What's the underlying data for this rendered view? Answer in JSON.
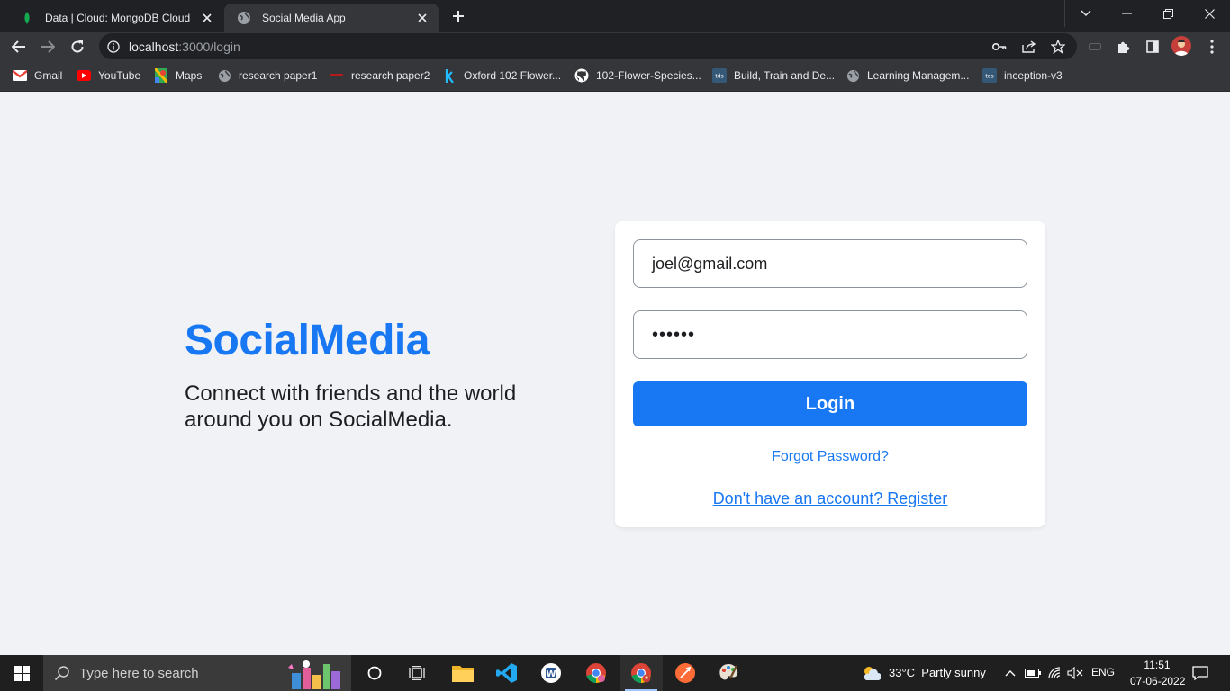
{
  "browser": {
    "tabs": [
      {
        "title": "Data | Cloud: MongoDB Cloud",
        "icon": "mongodb-leaf-icon",
        "active": false
      },
      {
        "title": "Social Media App",
        "icon": "globe-icon",
        "active": true
      }
    ],
    "address": {
      "host": "localhost",
      "path": ":3000/login"
    },
    "bookmarks": [
      {
        "label": "Gmail",
        "icon": "gmail-icon"
      },
      {
        "label": "YouTube",
        "icon": "youtube-icon"
      },
      {
        "label": "Maps",
        "icon": "maps-icon"
      },
      {
        "label": "research paper1",
        "icon": "globe-icon"
      },
      {
        "label": "research paper2",
        "icon": "red-dash-icon"
      },
      {
        "label": "Oxford 102 Flower...",
        "icon": "kaggle-icon"
      },
      {
        "label": "102-Flower-Species...",
        "icon": "github-icon"
      },
      {
        "label": "Build, Train and De...",
        "icon": "tds-icon"
      },
      {
        "label": "Learning Managem...",
        "icon": "globe-icon"
      },
      {
        "label": "inception-v3",
        "icon": "tds-icon"
      }
    ]
  },
  "page": {
    "brand": "SocialMedia",
    "tagline": "Connect with friends and the world around you on SocialMedia.",
    "form": {
      "email_value": "joel@gmail.com",
      "password_value": "••••••",
      "login_label": "Login",
      "forgot_label": "Forgot Password?",
      "register_label": "Don't have an account? Register"
    },
    "colors": {
      "accent": "#1877f2",
      "background": "#f0f2f5"
    }
  },
  "taskbar": {
    "search_placeholder": "Type here to search",
    "weather": {
      "temp": "33°C",
      "condition": "Partly sunny"
    },
    "language": "ENG",
    "time": "11:51",
    "date": "07-06-2022"
  }
}
